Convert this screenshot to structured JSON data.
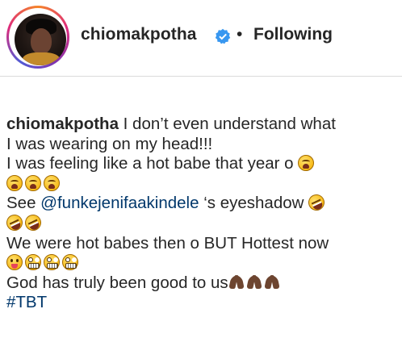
{
  "header": {
    "username": "chiomakpotha",
    "separator": "•",
    "follow_status": "Following",
    "verified": true
  },
  "caption": {
    "username": "chiomakpotha",
    "line1_text": " I don’t even understand what",
    "line2_text": "I was wearing on my head!!!",
    "line3_text": "I was feeling like a hot babe that year o ",
    "line5_pre": "See ",
    "mention": "@funkejenifaakindele",
    "line5_post": " ‘s eyeshadow ",
    "line7_text": "We were hot babes then o BUT Hottest now",
    "line9_text": "God has truly been good to us",
    "hashtag": "#TBT"
  },
  "emoji": {
    "weary": "weary-face",
    "rofl": "rolling-on-floor-laughing",
    "tongue": "face-with-tongue",
    "grimace": "grimacing-face",
    "pray": "folded-hands-dark-skin"
  },
  "colors": {
    "text": "#262626",
    "link": "#00376b",
    "verified": "#3897f0",
    "divider": "#dbdbdb"
  }
}
